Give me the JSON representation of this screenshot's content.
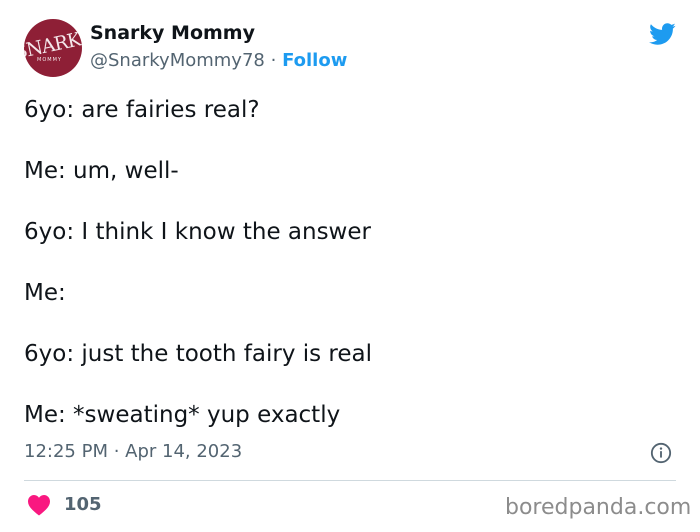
{
  "author": {
    "display_name": "Snarky Mommy",
    "handle": "@SnarkyMommy78",
    "separator": "·",
    "follow_label": "Follow",
    "avatar_monogram": "SNARKY",
    "avatar_subtext": "MOMMY",
    "avatar_color": "#8e1f36"
  },
  "tweet": {
    "lines": [
      "6yo: are fairies real?",
      "Me: um, well-",
      "6yo: I think I know the answer",
      "Me:",
      "6yo: just the tooth fairy is real",
      "Me: *sweating* yup exactly"
    ],
    "timestamp": "12:25 PM · Apr 14, 2023"
  },
  "engagement": {
    "like_count": "105",
    "heart_color": "#f91880"
  },
  "watermark": "boredpanda.com",
  "icons": {
    "brand": "twitter-bird-icon",
    "info": "info-icon",
    "like": "heart-icon"
  },
  "colors": {
    "accent": "#1d9bf0",
    "text_primary": "#0f1419",
    "text_secondary": "#536471"
  }
}
